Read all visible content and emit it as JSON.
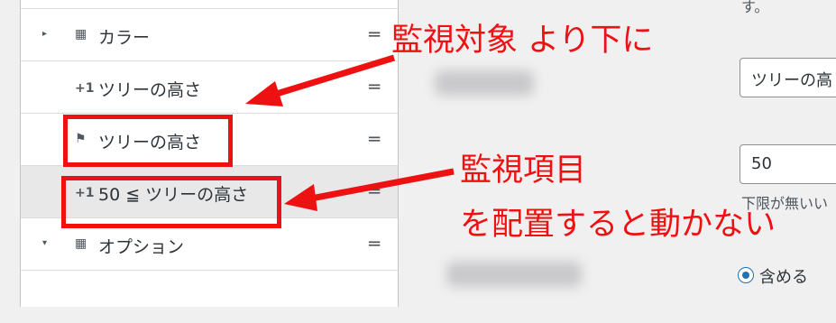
{
  "list": {
    "rows": [
      {
        "label": "カラー",
        "icon": "group-block-icon",
        "caret": "▸"
      },
      {
        "prefix": "+1",
        "label": "ツリーの高さ"
      },
      {
        "icon": "flag-icon",
        "label": "ツリーの高さ"
      },
      {
        "prefix": "+1",
        "label": "50 ≦ ツリーの高さ"
      },
      {
        "label": "オプション",
        "icon": "group-block-icon",
        "caret": "▾"
      }
    ],
    "handle_glyph": "═"
  },
  "annotations": {
    "arrow1_text": "監視対象 より下に",
    "arrow2_line1": "監視項目",
    "arrow2_line2": "を配置すると動かない"
  },
  "right_panel": {
    "top_text": "す。",
    "select_value": "ツリーの高",
    "input_value": "50",
    "helper_text": "下限が無いい",
    "radio_label": "含める",
    "accent_color": "#2271b1"
  },
  "colors": {
    "annotation_red": "#ee1111"
  }
}
